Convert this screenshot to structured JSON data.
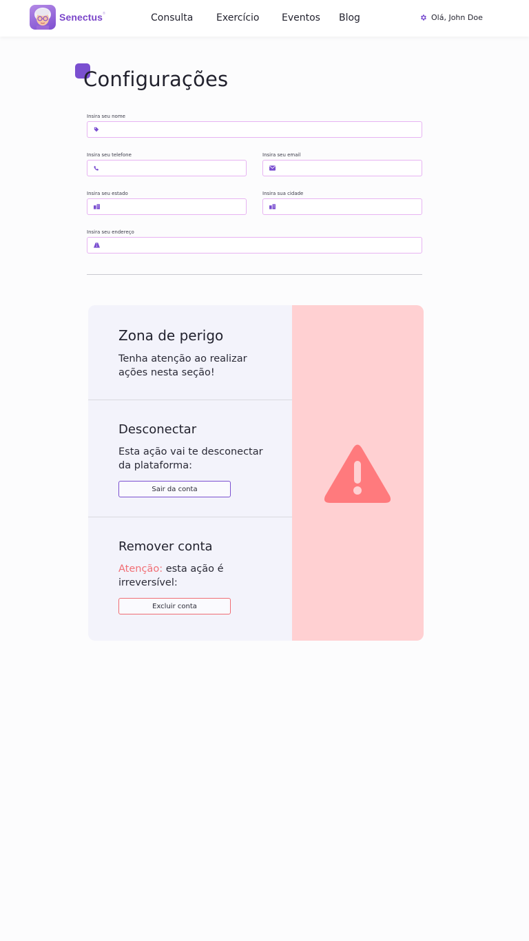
{
  "header": {
    "brand": "Senectus",
    "brand_mark": "®",
    "nav": [
      "Consulta",
      "Exercício",
      "Eventos",
      "Blog"
    ],
    "user_greeting": "Olá, John Doe",
    "user_icon": "gear-icon"
  },
  "page": {
    "title": "Configurações"
  },
  "form": {
    "nome": {
      "label": "Insira seu nome",
      "icon": "tag-icon",
      "value": ""
    },
    "telefone": {
      "label": "Insira seu telefone",
      "icon": "phone-icon",
      "value": ""
    },
    "email": {
      "label": "Insira seu email",
      "icon": "envelope-icon",
      "value": ""
    },
    "estado": {
      "label": "Insira seu estado",
      "icon": "city-icon",
      "value": ""
    },
    "cidade": {
      "label": "Insira sua cidade",
      "icon": "city-icon",
      "value": ""
    },
    "endereco": {
      "label": "Insira seu endereço",
      "icon": "road-icon",
      "value": ""
    }
  },
  "danger_zone": {
    "title": "Zona de perigo",
    "subtitle": "Tenha atenção ao realizar ações nesta seção!",
    "logout": {
      "title": "Desconectar",
      "text": "Esta ação vai te desconectar da plataforma:",
      "button": "Sair da conta"
    },
    "delete": {
      "title": "Remover conta",
      "warning_word": "Atenção:",
      "text": "esta ação é irreversível:",
      "button": "Excluir conta"
    },
    "icon": "warning-triangle-icon"
  },
  "colors": {
    "accent": "#7a4fd0",
    "input_border": "#e7b3f2",
    "danger_panel": "#ffd0d2",
    "danger_icon": "#ff7a7d",
    "danger_text": "#f16e75",
    "card_bg": "#f3f3fb"
  }
}
